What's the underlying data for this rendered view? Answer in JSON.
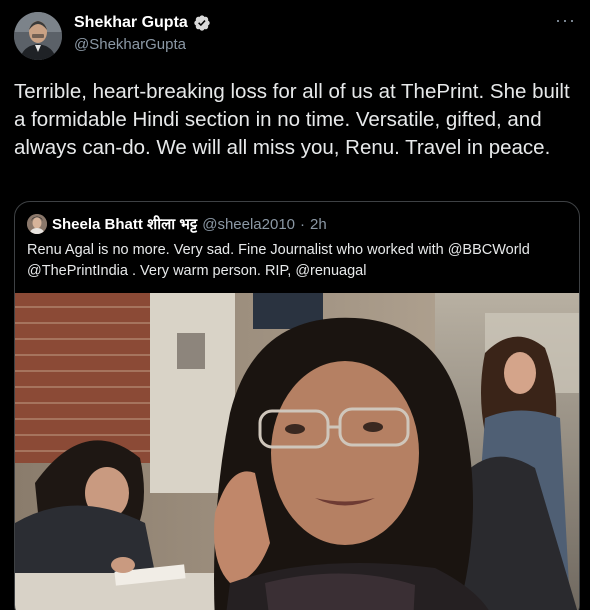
{
  "author": {
    "name": "Shekhar Gupta",
    "handle": "@ShekharGupta"
  },
  "menu": {
    "more": "···"
  },
  "tweet": {
    "text": "Terrible, heart-breaking loss for all of us at ThePrint. She built a formidable Hindi section in no time. Versatile, gifted, and always can-do. We will all miss you, Renu. Travel in peace."
  },
  "quoted": {
    "name": "Sheela Bhatt शीला भट्ट",
    "handle": "@sheela2010",
    "separator": "·",
    "time": "2h",
    "text": "Renu Agal is no more. Very sad. Fine Journalist who worked with @BBCWorld @ThePrintIndia . Very warm person. RIP, @renuagal"
  },
  "colors": {
    "background": "#000000",
    "verified": "#d9d9d9",
    "muted": "#8b98a5",
    "border": "#3e4144"
  }
}
